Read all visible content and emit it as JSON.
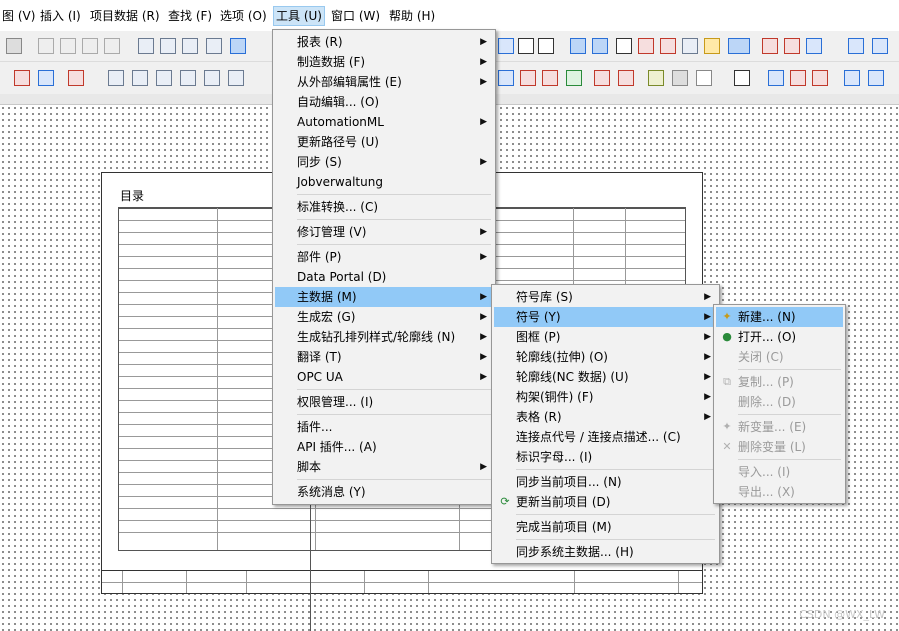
{
  "menubar": {
    "items": [
      "图 (V)",
      "插入 (I)",
      "项目数据 (R)",
      "查找 (F)",
      "选项 (O)",
      "工具 (U)",
      "窗口 (W)",
      "帮助 (H)"
    ],
    "active": "工具 (U)"
  },
  "drawing": {
    "sheet_title": "目录",
    "watermark": "CSDN @WX_LW"
  },
  "tools_menu": {
    "items": [
      {
        "label": "报表 (R)",
        "submenu": true
      },
      {
        "label": "制造数据 (F)",
        "submenu": true
      },
      {
        "label": "从外部编辑属性 (E)",
        "submenu": true
      },
      {
        "label": "自动编辑... (O)",
        "submenu": false
      },
      {
        "label": "AutomationML",
        "submenu": true
      },
      {
        "label": "更新路径号 (U)",
        "submenu": false
      },
      {
        "label": "同步 (S)",
        "submenu": true
      },
      {
        "label": "Jobverwaltung",
        "submenu": false
      },
      {
        "label": "标准转换... (C)",
        "submenu": false
      },
      {
        "label": "修订管理 (V)",
        "submenu": true
      },
      {
        "label": "部件 (P)",
        "submenu": true
      },
      {
        "label": "Data Portal (D)",
        "submenu": false
      },
      {
        "label": "主数据 (M)",
        "submenu": true
      },
      {
        "label": "生成宏 (G)",
        "submenu": true
      },
      {
        "label": "生成钻孔排列样式/轮廓线 (N)",
        "submenu": true
      },
      {
        "label": "翻译 (T)",
        "submenu": true
      },
      {
        "label": "OPC UA",
        "submenu": true
      },
      {
        "label": "权限管理... (I)",
        "submenu": false
      },
      {
        "label": "插件...",
        "submenu": false
      },
      {
        "label": "API 插件... (A)",
        "submenu": false
      },
      {
        "label": "脚本",
        "submenu": true
      },
      {
        "label": "系统消息 (Y)",
        "submenu": false
      }
    ]
  },
  "master_data_menu": {
    "items": [
      {
        "label": "符号库 (S)",
        "submenu": true
      },
      {
        "label": "符号 (Y)",
        "submenu": true
      },
      {
        "label": "图框 (P)",
        "submenu": true
      },
      {
        "label": "轮廓线(拉伸) (O)",
        "submenu": true
      },
      {
        "label": "轮廓线(NC 数据) (U)",
        "submenu": true
      },
      {
        "label": "构架(铜件) (F)",
        "submenu": true
      },
      {
        "label": "表格 (R)",
        "submenu": true
      },
      {
        "label": "连接点代号 / 连接点描述... (C)",
        "submenu": false
      },
      {
        "label": "标识字母... (I)",
        "submenu": false
      },
      {
        "label": "同步当前项目... (N)",
        "submenu": false
      },
      {
        "label": "更新当前项目 (D)",
        "submenu": false
      },
      {
        "label": "完成当前项目 (M)",
        "submenu": false
      },
      {
        "label": "同步系统主数据... (H)",
        "submenu": false
      }
    ]
  },
  "symbol_menu": {
    "items": [
      {
        "label": "新建... (N)",
        "enabled": true,
        "icon": "new-symbol-icon"
      },
      {
        "label": "打开... (O)",
        "enabled": true,
        "icon": "open-symbol-icon"
      },
      {
        "label": "关闭 (C)",
        "enabled": false,
        "icon": ""
      },
      {
        "label": "复制... (P)",
        "enabled": false,
        "icon": "copy-icon"
      },
      {
        "label": "删除... (D)",
        "enabled": false,
        "icon": ""
      },
      {
        "label": "新变量... (E)",
        "enabled": false,
        "icon": "new-variant-icon"
      },
      {
        "label": "删除变量 (L)",
        "enabled": false,
        "icon": "delete-variant-icon"
      },
      {
        "label": "导入... (I)",
        "enabled": false,
        "icon": ""
      },
      {
        "label": "导出... (X)",
        "enabled": false,
        "icon": ""
      }
    ]
  },
  "colors": {
    "highlight": "#91c9f7",
    "menu_bg": "#f2f2f2",
    "disabled_text": "#9a9a9a"
  }
}
